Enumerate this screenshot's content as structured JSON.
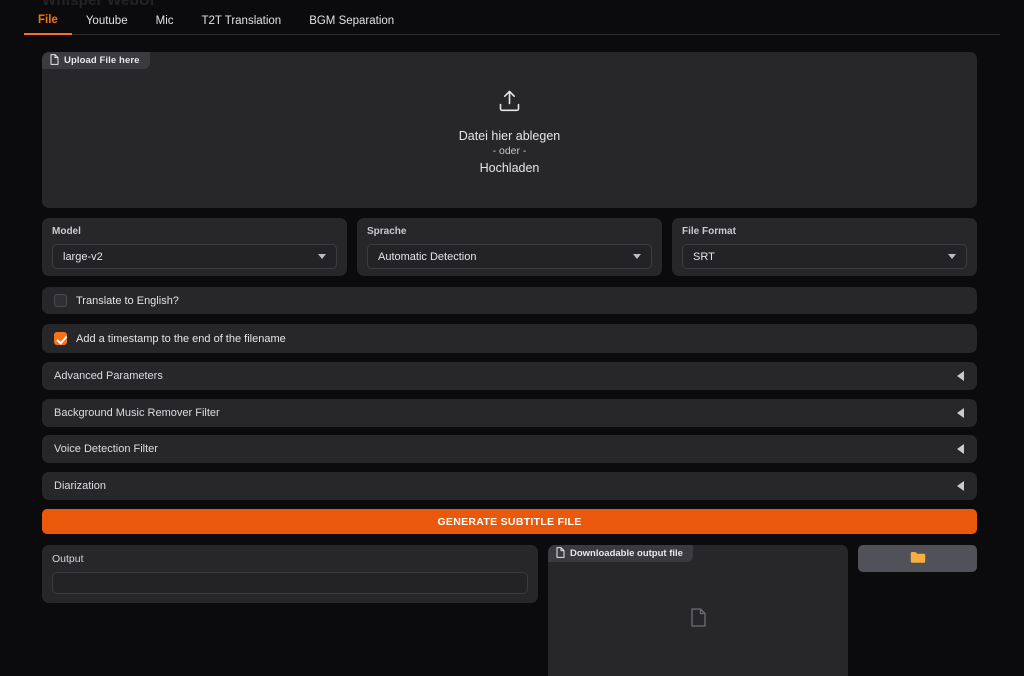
{
  "app": {
    "title": "Whisper WebUI",
    "accent_color": "#f97316",
    "button_color": "#ea580c",
    "panel_color": "#27272a",
    "background_color": "#0b0b0d"
  },
  "tabs": [
    {
      "label": "File",
      "active": true
    },
    {
      "label": "Youtube",
      "active": false
    },
    {
      "label": "Mic",
      "active": false
    },
    {
      "label": "T2T Translation",
      "active": false
    },
    {
      "label": "BGM Separation",
      "active": false
    }
  ],
  "upload": {
    "chip_label": "Upload File here",
    "chip_icon": "file-icon",
    "drop_icon": "upload-icon",
    "line1": "Datei hier ablegen",
    "line2": "- oder -",
    "line3": "Hochladen"
  },
  "dropdowns": [
    {
      "label": "Model",
      "value": "large-v2",
      "icon": "chevron-down-icon"
    },
    {
      "label": "Sprache",
      "value": "Automatic Detection",
      "icon": "chevron-down-icon"
    },
    {
      "label": "File Format",
      "value": "SRT",
      "icon": "chevron-down-icon"
    }
  ],
  "checkboxes": [
    {
      "label": "Translate to English?",
      "checked": false
    },
    {
      "label": "Add a timestamp to the end of the filename",
      "checked": true
    }
  ],
  "accordions": [
    {
      "label": "Advanced Parameters",
      "expanded": false,
      "icon": "caret-left-icon"
    },
    {
      "label": "Background Music Remover Filter",
      "expanded": false,
      "icon": "caret-left-icon"
    },
    {
      "label": "Voice Detection Filter",
      "expanded": false,
      "icon": "caret-left-icon"
    },
    {
      "label": "Diarization",
      "expanded": false,
      "icon": "caret-left-icon"
    }
  ],
  "generate_button": {
    "label": "GENERATE SUBTITLE FILE"
  },
  "output": {
    "label": "Output",
    "value": ""
  },
  "download": {
    "chip_label": "Downloadable output file",
    "chip_icon": "file-icon",
    "placeholder_icon": "file-icon"
  },
  "folder_button": {
    "icon": "folder-icon",
    "icon_color": "#f5b041"
  }
}
